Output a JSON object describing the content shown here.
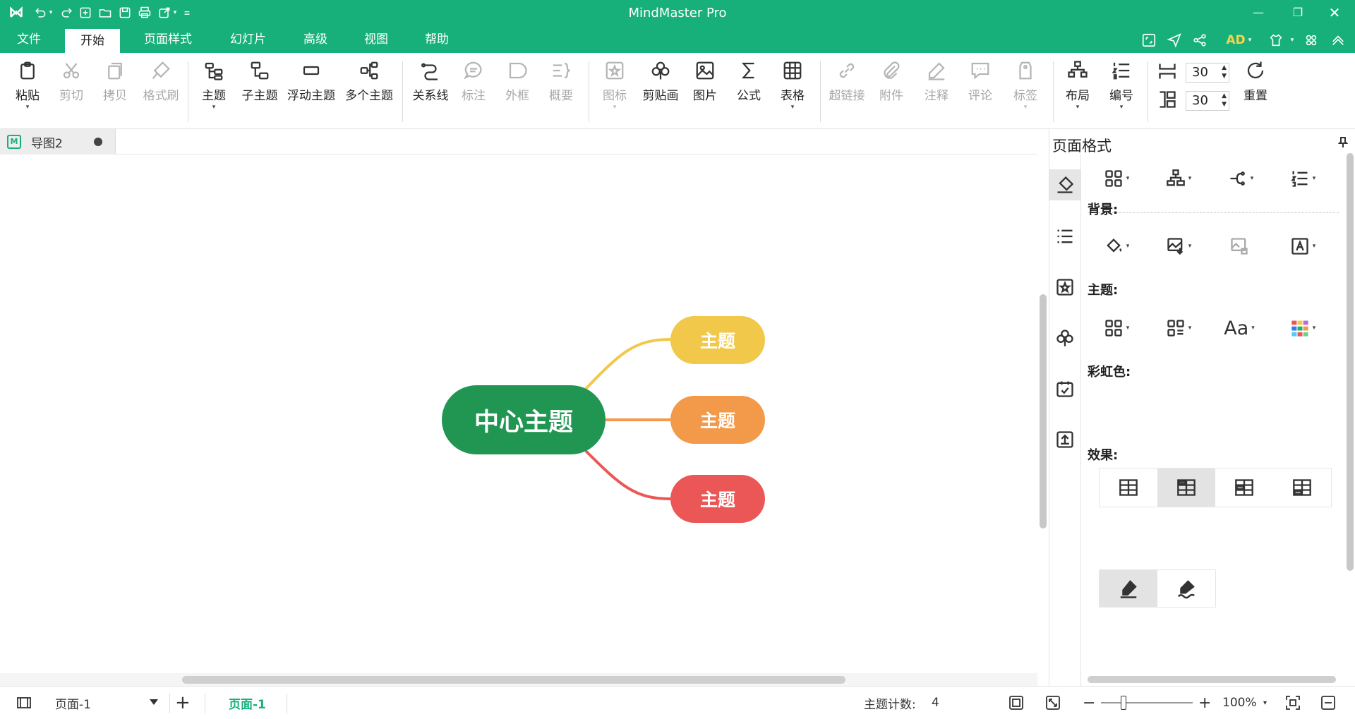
{
  "app": {
    "title": "MindMaster Pro",
    "accent": "#17b07a"
  },
  "menu": {
    "tabs": [
      "文件",
      "开始",
      "页面样式",
      "幻灯片",
      "高级",
      "视图",
      "帮助"
    ],
    "active": "开始",
    "user": "AD"
  },
  "ribbon": {
    "paste": "粘贴",
    "cut": "剪切",
    "copy": "拷贝",
    "format_painter": "格式刷",
    "topic": "主题",
    "subtopic": "子主题",
    "floating_topic": "浮动主题",
    "multiple_topics": "多个主题",
    "relationship": "关系线",
    "callout": "标注",
    "boundary": "外框",
    "summary": "概要",
    "icon": "图标",
    "clipart": "剪贴画",
    "picture": "图片",
    "formula": "公式",
    "table": "表格",
    "hyperlink": "超链接",
    "attachment": "附件",
    "note": "注释",
    "comment": "评论",
    "tag": "标签",
    "layout": "布局",
    "numbering": "编号",
    "reset": "重置",
    "h_spacing": "30",
    "v_spacing": "30"
  },
  "document": {
    "tab_name": "导图2"
  },
  "mindmap": {
    "central": {
      "label": "中心主题",
      "color": "#219653"
    },
    "branches": [
      {
        "label": "主题",
        "color": "#f2c84b"
      },
      {
        "label": "主题",
        "color": "#f2994a"
      },
      {
        "label": "主题",
        "color": "#eb5757"
      }
    ]
  },
  "panel": {
    "title": "页面格式",
    "background_label": "背景:",
    "theme_label": "主题:",
    "rainbow_label": "彩虹色:",
    "effect_label": "效果:"
  },
  "status": {
    "page_select": "页面-1",
    "page_tab": "页面-1",
    "topic_count_label": "主题计数:",
    "topic_count": "4",
    "zoom": "100%"
  }
}
